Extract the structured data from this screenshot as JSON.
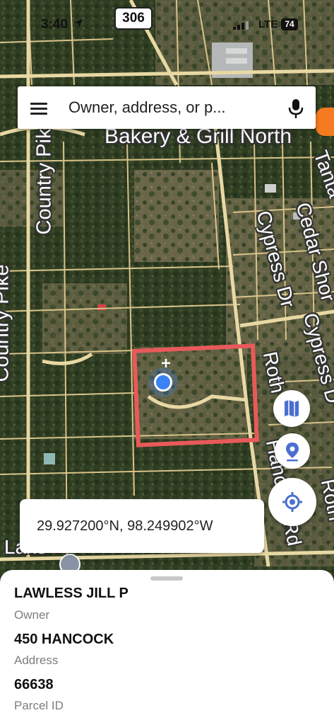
{
  "status_bar": {
    "time": "3:40",
    "network": "LTE",
    "battery": "74"
  },
  "map": {
    "route_shield": "306",
    "labels": {
      "bakery": "Bakery & Grill North",
      "country_pike": "Country Pike",
      "country_pik": "Country Pik",
      "cypress_dr_1": "Cypress Dr",
      "cypress_dr_2": "Cypress D",
      "cedar_shor": "Cedar Shor",
      "tanta": "Tanta",
      "roth_1": "Roth",
      "roth_2": "Roth",
      "hancock_rd": "Hancock Rd",
      "lake": "Lake"
    },
    "parcel_color": "#e85a5a",
    "location_color": "#3b82f6"
  },
  "search": {
    "placeholder": "Owner, address, or p..."
  },
  "buttons": {
    "layers": "map-layers",
    "pin": "drop-pin",
    "locate": "my-location"
  },
  "coordinates": "29.927200°N, 98.249902°W",
  "details": [
    {
      "value": "LAWLESS JILL P",
      "label": "Owner"
    },
    {
      "value": "450 HANCOCK",
      "label": "Address"
    },
    {
      "value": "66638",
      "label": "Parcel ID"
    }
  ]
}
